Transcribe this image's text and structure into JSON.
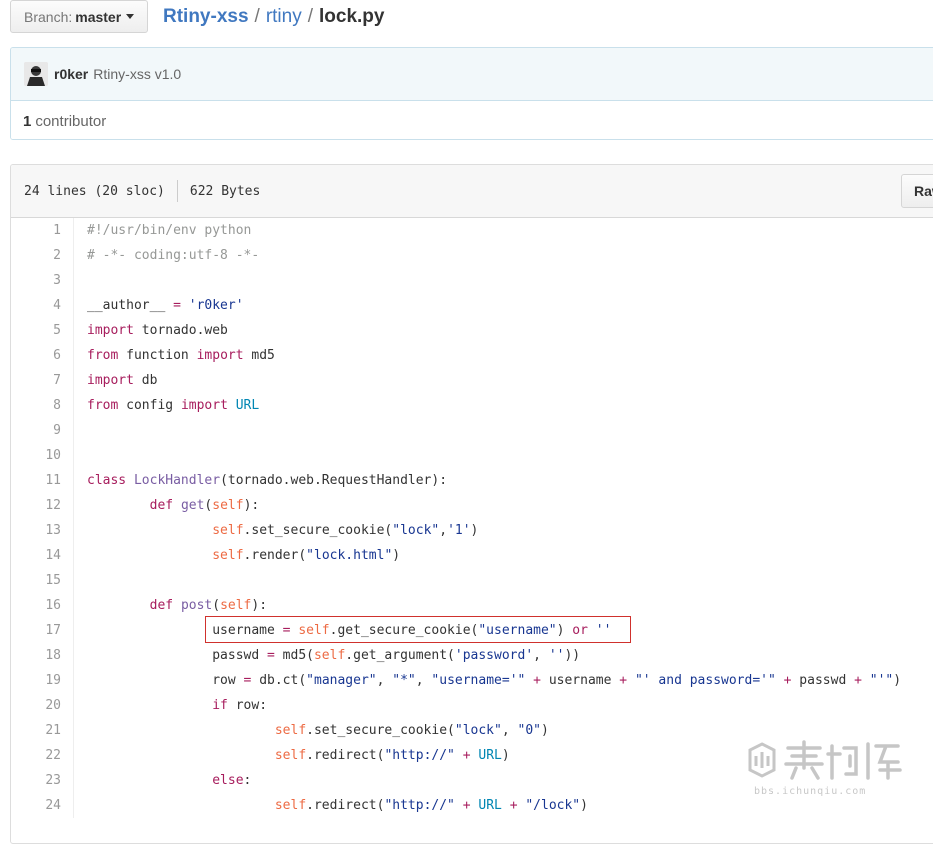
{
  "branch": {
    "label": "Branch:",
    "value": "master"
  },
  "breadcrumb": {
    "repo": "Rtiny-xss",
    "sep": "/",
    "dir": "rtiny",
    "file": "lock.py"
  },
  "commit": {
    "author": "r0ker",
    "message": "Rtiny-xss v1.0",
    "contributors_count": "1",
    "contributors_label": "contributor"
  },
  "file_info": {
    "lines": "24 lines (20 sloc)",
    "size": "622 Bytes",
    "raw_label": "Raw"
  },
  "code": [
    "#!/usr/bin/env python",
    "# -*- coding:utf-8 -*-",
    "",
    "__author__ = 'r0ker'",
    "import tornado.web",
    "from function import md5",
    "import db",
    "from config import URL",
    "",
    "",
    "class LockHandler(tornado.web.RequestHandler):",
    "        def get(self):",
    "                self.set_secure_cookie(\"lock\",'1')",
    "                self.render(\"lock.html\")",
    "",
    "        def post(self):",
    "                username = self.get_secure_cookie(\"username\") or ''",
    "                passwd = md5(self.get_argument('password', ''))",
    "                row = db.ct(\"manager\", \"*\", \"username='\" + username + \"' and password='\" + passwd + \"'\")",
    "                if row:",
    "                        self.set_secure_cookie(\"lock\", \"0\")",
    "                        self.redirect(\"http://\" + URL)",
    "                else:",
    "                        self.redirect(\"http://\" + URL + \"/lock\")"
  ],
  "watermark": {
    "text": "bbs.ichunqiu.com"
  }
}
